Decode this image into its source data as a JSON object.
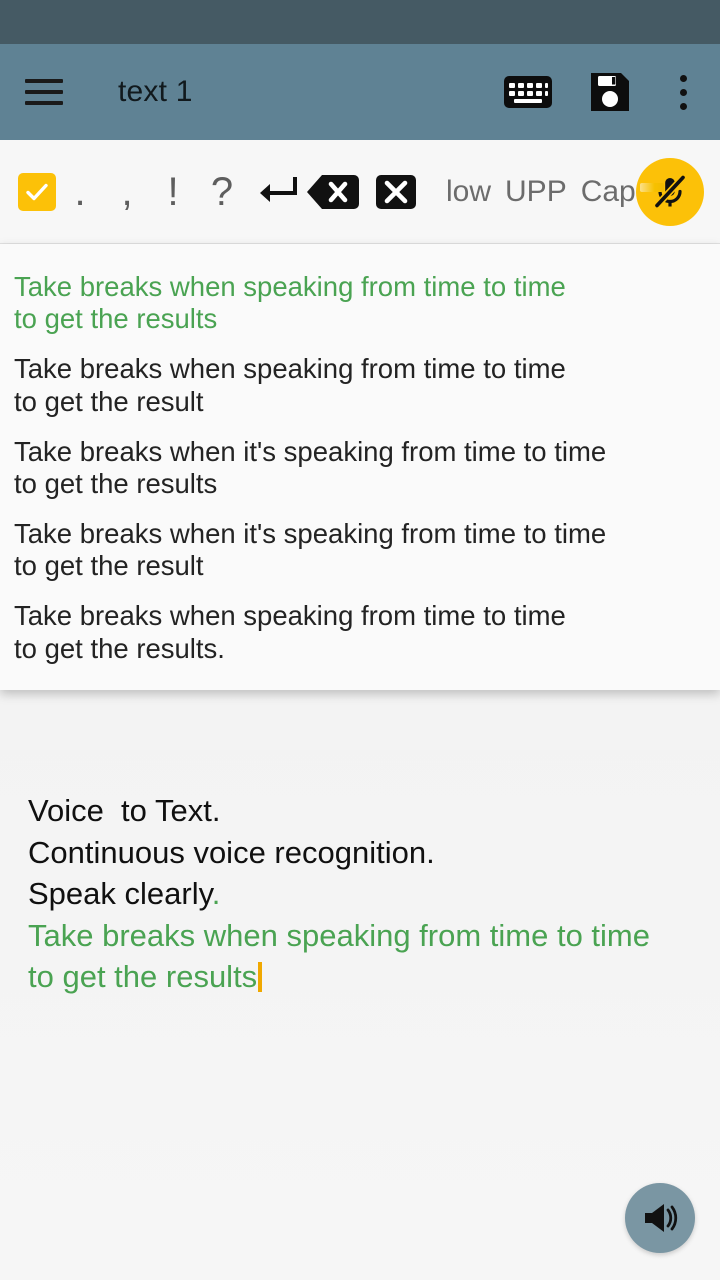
{
  "app": {
    "title": "text 1",
    "accent_yellow": "#fcc108",
    "accent_green": "#4aa352",
    "appbar_bg": "#5f8294",
    "statusbar_bg": "#455a64",
    "caret_color": "#f0a800"
  },
  "appbar": {
    "menu_icon": "hamburger-menu-icon",
    "title": "text 1",
    "actions": [
      {
        "name": "keyboard-icon",
        "label": "Keyboard"
      },
      {
        "name": "save-icon",
        "label": "Save"
      },
      {
        "name": "overflow-menu-icon",
        "label": "More options"
      }
    ]
  },
  "toolbar": {
    "checkbox": {
      "name": "select-all-checkbox",
      "checked": true,
      "glyph": "✓"
    },
    "punctuation": [
      {
        "name": "period-button",
        "label": "."
      },
      {
        "name": "comma-button",
        "label": ","
      },
      {
        "name": "exclamation-button",
        "label": "!"
      },
      {
        "name": "question-button",
        "label": "?"
      },
      {
        "name": "newline-button",
        "label": "↩"
      }
    ],
    "backspace": {
      "name": "backspace-button",
      "glyph": "×"
    },
    "clear": {
      "name": "clear-all-button",
      "glyph": "×"
    },
    "case_buttons": [
      {
        "name": "lowercase-button",
        "label": "low"
      },
      {
        "name": "uppercase-button",
        "label": "UPP"
      },
      {
        "name": "capitalize-button",
        "label": "Cap"
      }
    ],
    "case_marker": {
      "name": "case-active-marker"
    },
    "mic": {
      "name": "mic-muted-button",
      "label": "Microphone muted",
      "active": false
    }
  },
  "suggestions": {
    "items": [
      {
        "line1": "Take breaks when speaking from time to time",
        "line2": "to get the results",
        "selected": true
      },
      {
        "line1": "Take breaks when speaking from time to time",
        "line2": "to get the result",
        "selected": false
      },
      {
        "line1": "Take breaks when it's speaking from time to time",
        "line2": "to get the results",
        "selected": false
      },
      {
        "line1": "Take breaks when it's speaking from time to time",
        "line2": "to get the result",
        "selected": false
      },
      {
        "line1": "Take breaks when speaking from time to time",
        "line2": "to get the results.",
        "selected": false
      }
    ]
  },
  "editor": {
    "lines": [
      {
        "text": "Voice  to Text.",
        "color": "black"
      },
      {
        "text": "Continuous voice recognition.",
        "color": "black"
      },
      {
        "text": "Speak clearly",
        "tail": ".",
        "color": "black-with-green-tail"
      },
      {
        "text": "Take breaks when speaking from time to time",
        "color": "green"
      },
      {
        "text": "to get the results",
        "color": "green",
        "caret": true
      }
    ]
  },
  "speak_fab": {
    "name": "speak-aloud-button",
    "label": "Speak aloud"
  }
}
